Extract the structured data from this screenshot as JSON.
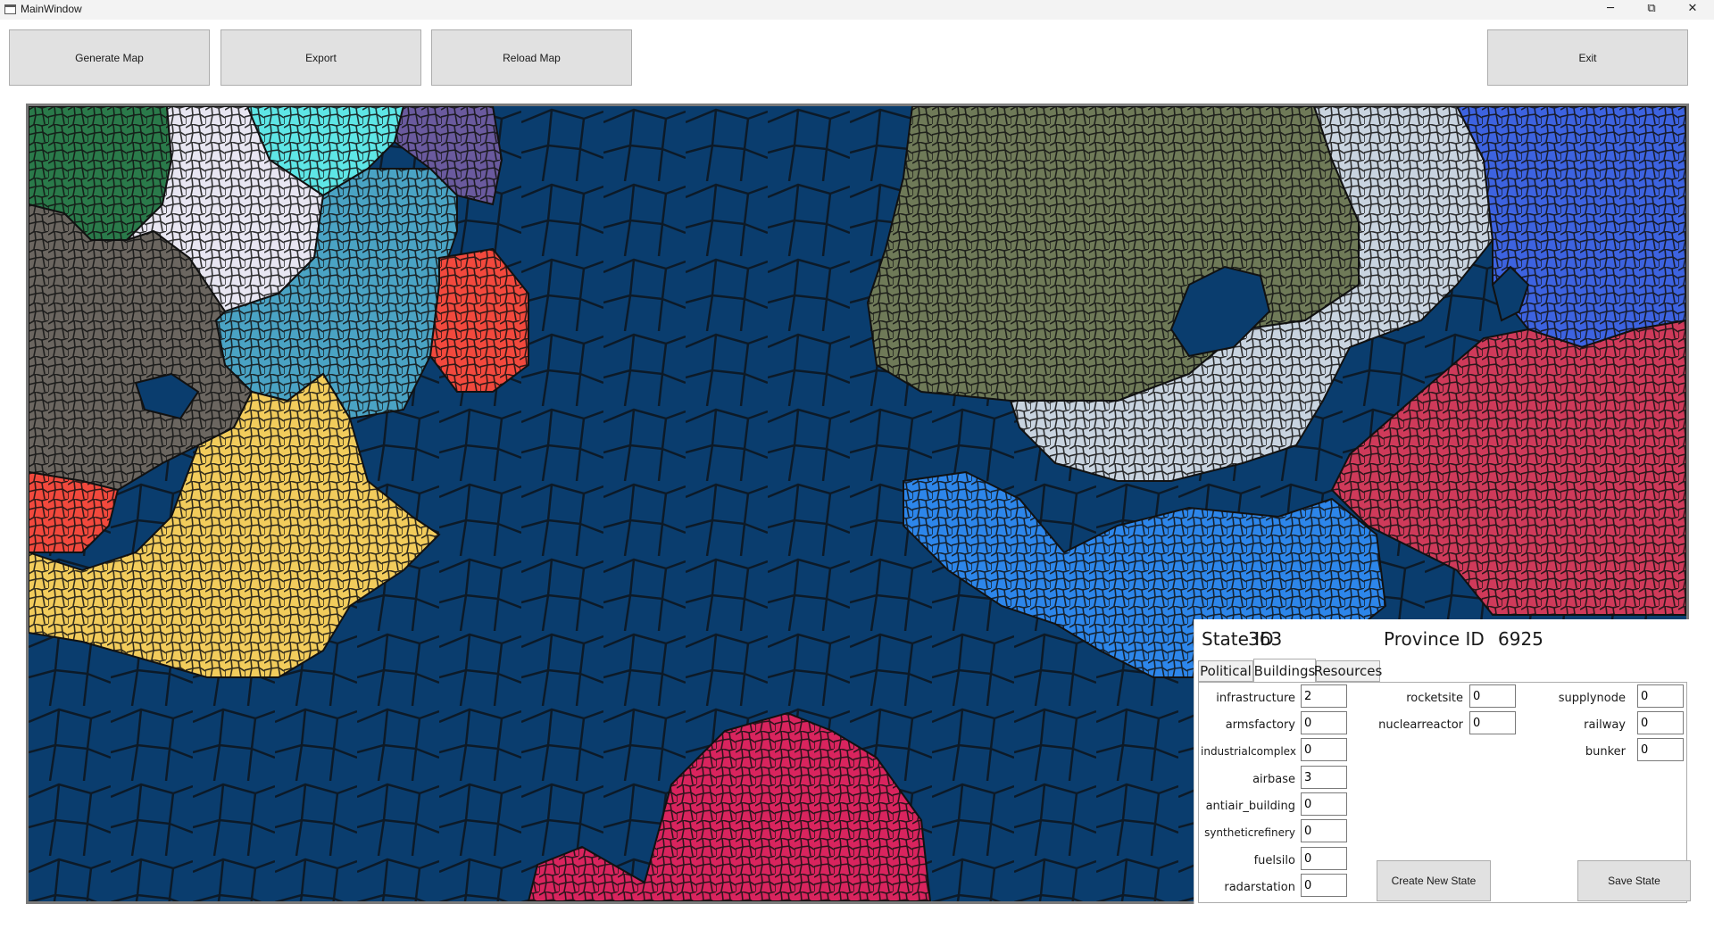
{
  "window": {
    "title": "MainWindow",
    "minimize_glyph": "─",
    "restore_glyph": "⧉",
    "close_glyph": "✕"
  },
  "toolbar": {
    "generate_label": "Generate Map",
    "export_label": "Export",
    "reload_label": "Reload Map",
    "exit_label": "Exit"
  },
  "map": {
    "ocean_color": "#0a3d6e",
    "region_colors": {
      "dark-green": "#2a7a4a",
      "lavender": "#e8e6f2",
      "cyan": "#5ee6e6",
      "purple": "#6a5a9e",
      "steel-blue": "#4aa3c4",
      "red": "#f2493d",
      "gray": "#6b6660",
      "yellow": "#f2cc5c",
      "olive": "#6f7a58",
      "light-gray": "#c9d4e0",
      "royal-blue": "#3d63e0",
      "crimson": "#cf3a5a",
      "azure": "#2d86ea",
      "magenta": "#d9245e"
    }
  },
  "state_panel": {
    "state_id_label": "State ID",
    "state_id_value": "363",
    "province_id_label": "Province ID",
    "province_id_value": "6925",
    "tabs": [
      "Political",
      "Buildings",
      "Resources"
    ],
    "active_tab": "Buildings",
    "buildings": {
      "col1": [
        {
          "label": "infrastructure",
          "value": "2"
        },
        {
          "label": "armsfactory",
          "value": "0"
        },
        {
          "label": "industrialcomplex",
          "value": "0"
        },
        {
          "label": "airbase",
          "value": "3"
        },
        {
          "label": "antiair_building",
          "value": "0"
        },
        {
          "label": "syntheticrefinery",
          "value": "0"
        },
        {
          "label": "fuelsilo",
          "value": "0"
        },
        {
          "label": "radarstation",
          "value": "0"
        }
      ],
      "col2": [
        {
          "label": "rocketsite",
          "value": "0"
        },
        {
          "label": "nuclearreactor",
          "value": "0"
        }
      ],
      "col3": [
        {
          "label": "supplynode",
          "value": "0"
        },
        {
          "label": "railway",
          "value": "0"
        },
        {
          "label": "bunker",
          "value": "0"
        }
      ]
    },
    "create_state_label": "Create New State",
    "save_state_label": "Save State"
  }
}
